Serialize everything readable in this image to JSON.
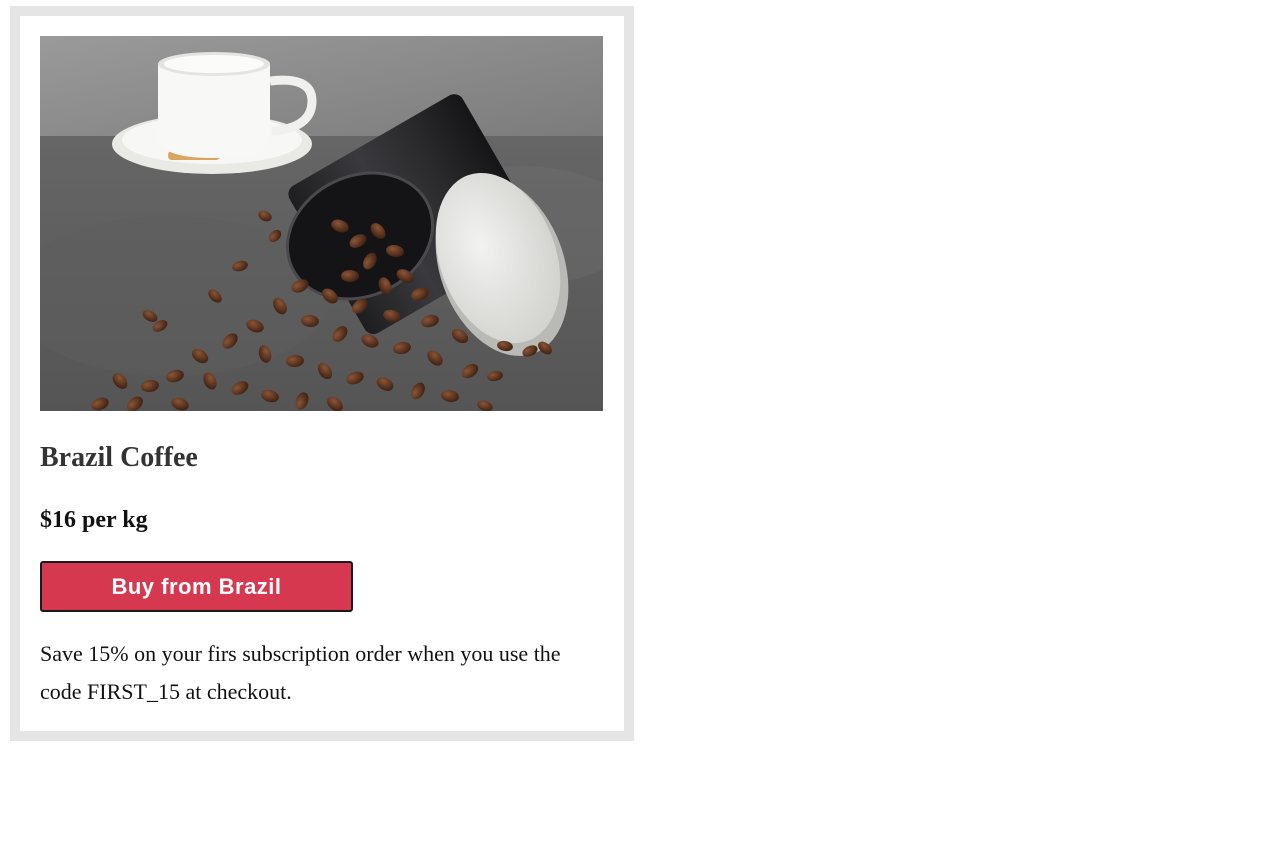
{
  "product": {
    "image_subject": "coffee-beans-spilling-from-tin-with-cup",
    "title": "Brazil Coffee",
    "price": "$16 per kg",
    "button_label": "Buy from Brazil",
    "promo_text": "Save 15% on your firs subscription order when you use the code FIRST_15 at checkout."
  },
  "colors": {
    "card_border": "#e5e5e5",
    "button_bg": "#d63850",
    "button_text": "#ffffff",
    "title_text": "#333333"
  }
}
